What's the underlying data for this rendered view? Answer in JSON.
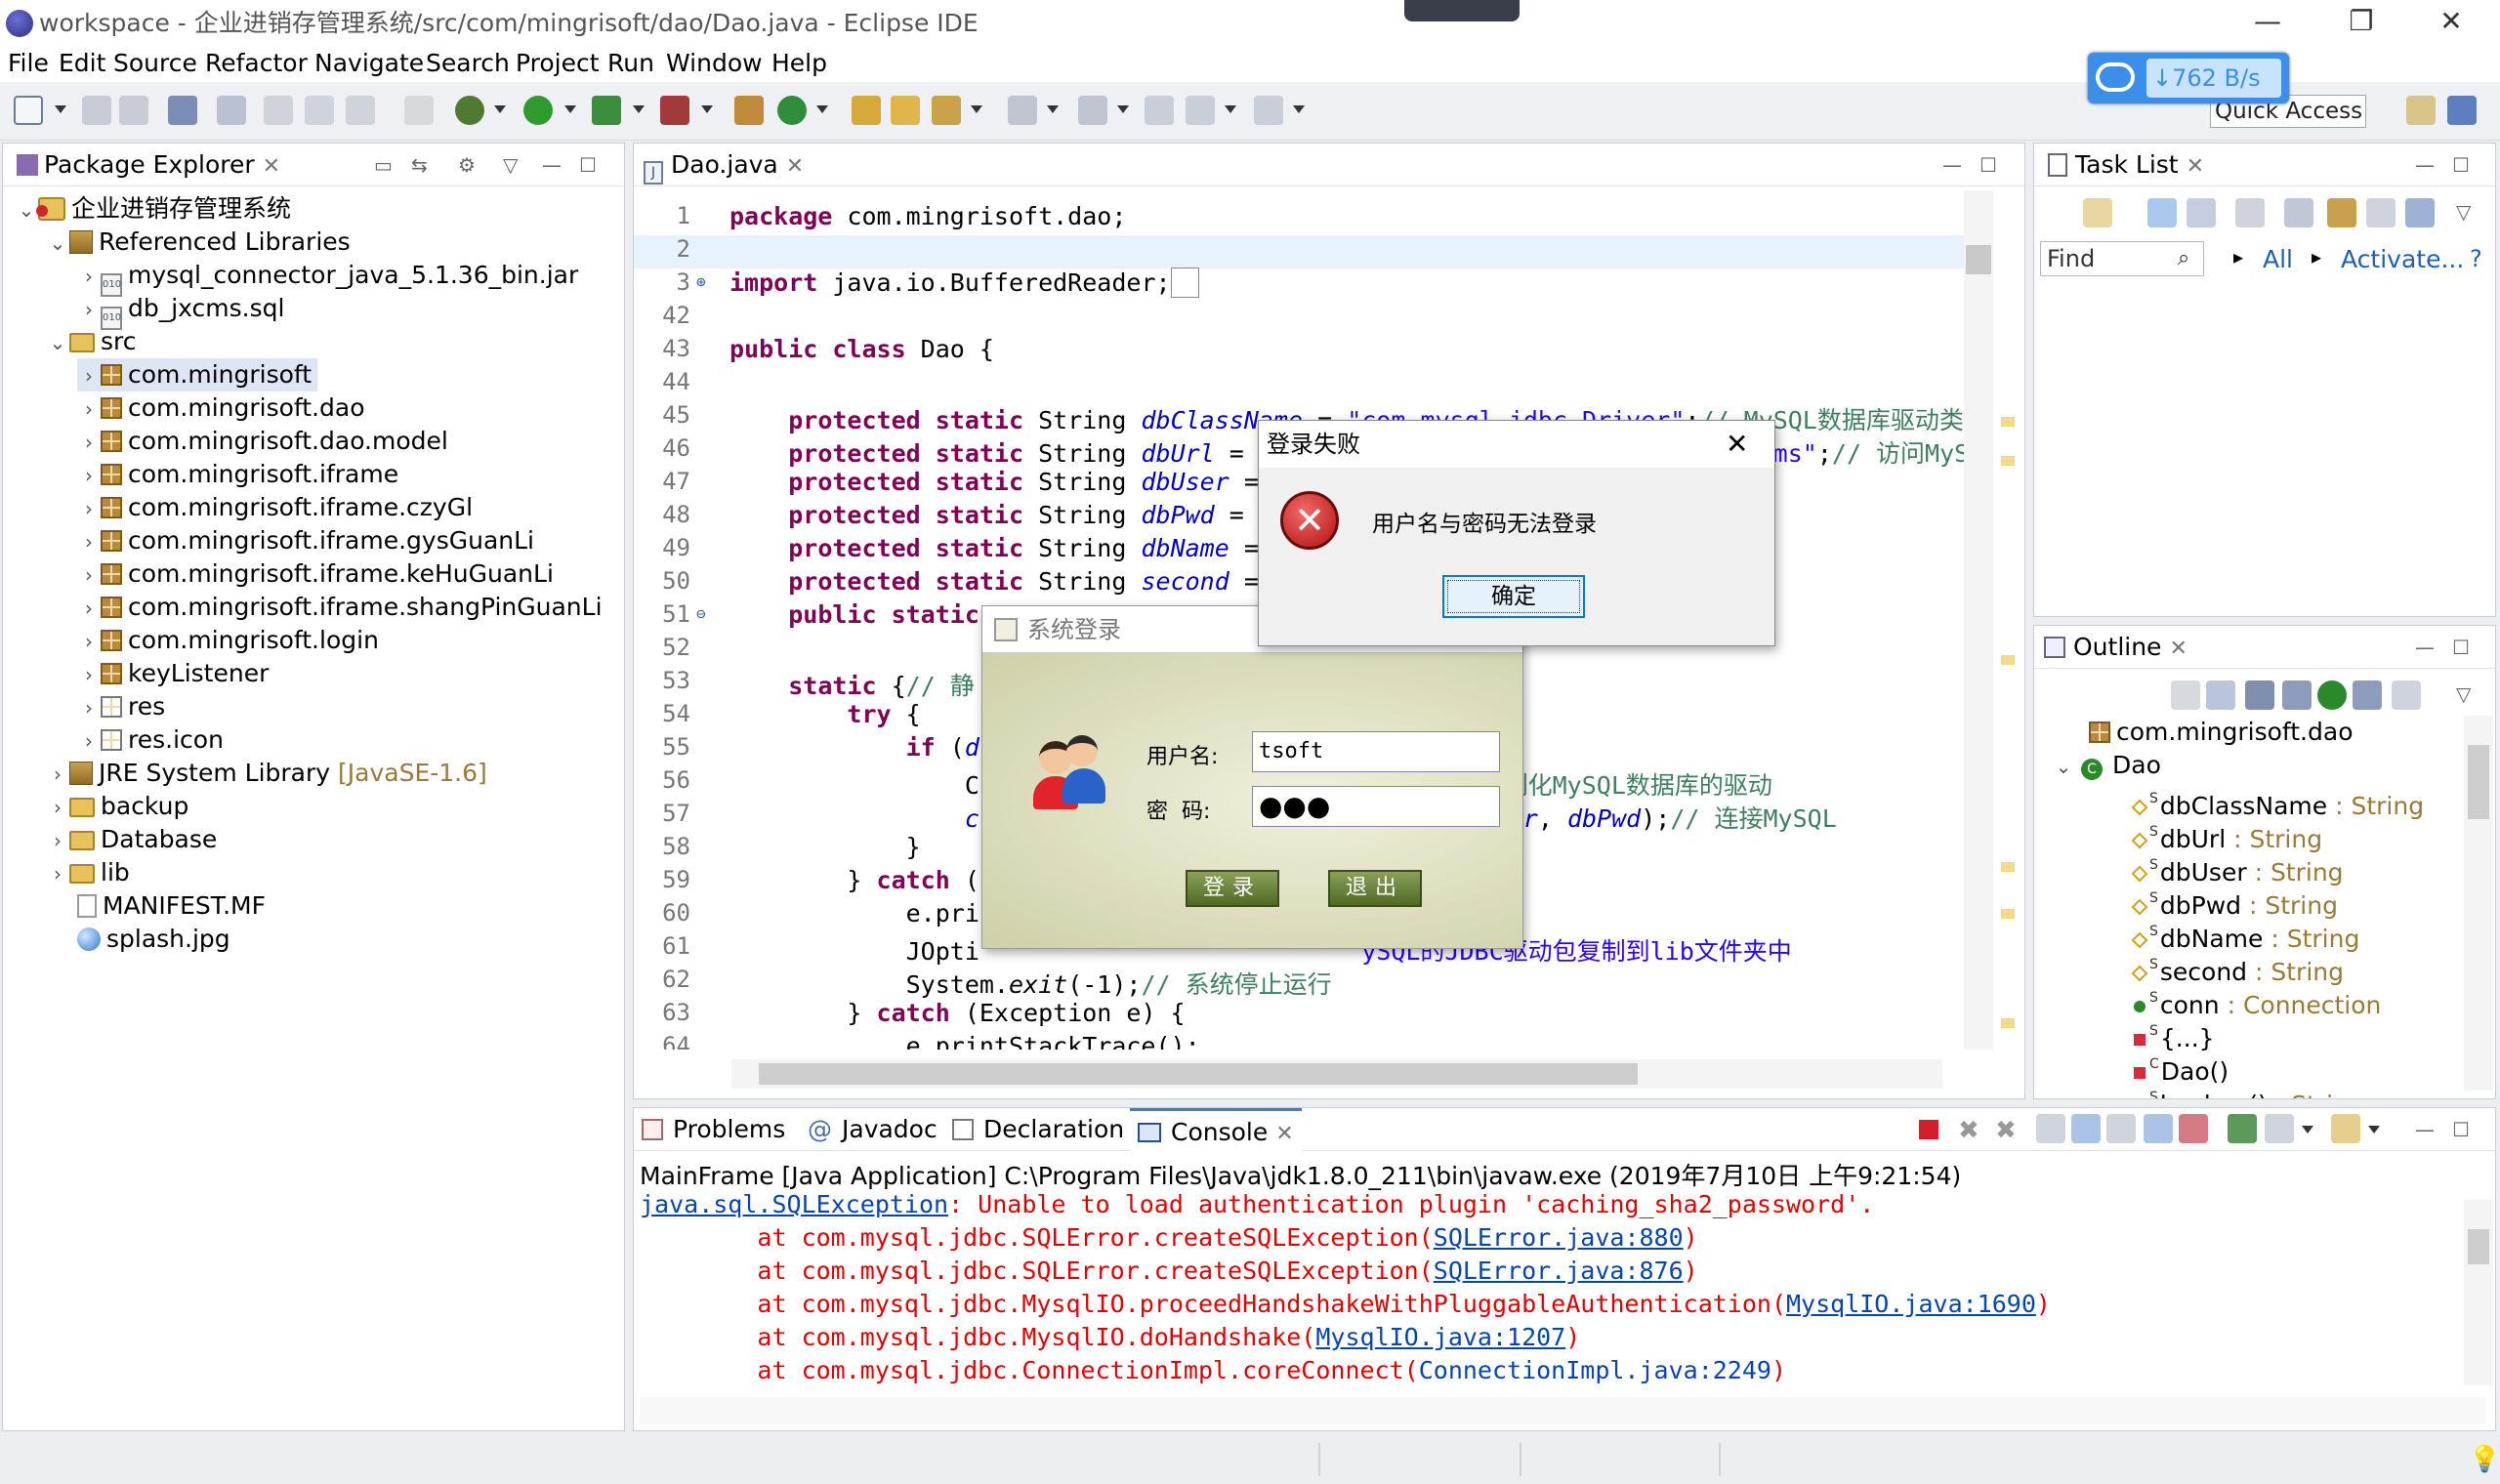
{
  "window": {
    "title": "workspace - 企业进销存管理系统/src/com/mingrisoft/dao/Dao.java - Eclipse IDE",
    "minimize": "—",
    "restore": "❐",
    "close": "✕"
  },
  "menu": [
    "File",
    "Edit",
    "Source",
    "Refactor",
    "Navigate",
    "Search",
    "Project",
    "Run",
    "Window",
    "Help"
  ],
  "quick_access": "Quick Access",
  "net_speed": "762 B/s",
  "package_explorer": {
    "tab": "Package Explorer",
    "rows": [
      {
        "label": "企业进销存管理系统",
        "extra": ""
      },
      {
        "label": "Referenced Libraries",
        "extra": ""
      },
      {
        "label": "mysql_connector_java_5.1.36_bin.jar",
        "extra": ""
      },
      {
        "label": "db_jxcms.sql",
        "extra": ""
      },
      {
        "label": "src",
        "extra": ""
      },
      {
        "label": "com.mingrisoft",
        "extra": ""
      },
      {
        "label": "com.mingrisoft.dao",
        "extra": ""
      },
      {
        "label": "com.mingrisoft.dao.model",
        "extra": ""
      },
      {
        "label": "com.mingrisoft.iframe",
        "extra": ""
      },
      {
        "label": "com.mingrisoft.iframe.czyGl",
        "extra": ""
      },
      {
        "label": "com.mingrisoft.iframe.gysGuanLi",
        "extra": ""
      },
      {
        "label": "com.mingrisoft.iframe.keHuGuanLi",
        "extra": ""
      },
      {
        "label": "com.mingrisoft.iframe.shangPinGuanLi",
        "extra": ""
      },
      {
        "label": "com.mingrisoft.login",
        "extra": ""
      },
      {
        "label": "keyListener",
        "extra": ""
      },
      {
        "label": "res",
        "extra": ""
      },
      {
        "label": "res.icon",
        "extra": ""
      },
      {
        "label": "JRE System Library",
        "extra": "[JavaSE-1.6]"
      },
      {
        "label": "backup",
        "extra": ""
      },
      {
        "label": "Database",
        "extra": ""
      },
      {
        "label": "lib",
        "extra": ""
      },
      {
        "label": "MANIFEST.MF",
        "extra": ""
      },
      {
        "label": "splash.jpg",
        "extra": ""
      }
    ]
  },
  "editor": {
    "tab": "Dao.java",
    "line_numbers": [
      "1",
      "2",
      "3",
      "42",
      "43",
      "44",
      "45",
      "46",
      "47",
      "48",
      "49",
      "50",
      "51",
      "52",
      "53",
      "54",
      "55",
      "56",
      "57",
      "58",
      "59",
      "60",
      "61",
      "62",
      "63",
      "64"
    ]
  },
  "task_list": {
    "tab": "Task List",
    "find_placeholder": "Find",
    "all": "All",
    "activate": "Activate..."
  },
  "outline": {
    "tab": "Outline",
    "items": [
      {
        "name": "com.mingrisoft.dao",
        "type": ""
      },
      {
        "name": "Dao",
        "type": ""
      },
      {
        "name": "dbClassName",
        "type": " : String"
      },
      {
        "name": "dbUrl",
        "type": " : String"
      },
      {
        "name": "dbUser",
        "type": " : String"
      },
      {
        "name": "dbPwd",
        "type": " : String"
      },
      {
        "name": "dbName",
        "type": " : String"
      },
      {
        "name": "second",
        "type": " : String"
      },
      {
        "name": "conn",
        "type": " : Connection"
      },
      {
        "name": "{...}",
        "type": ""
      },
      {
        "name": "Dao()",
        "type": ""
      },
      {
        "name": "backup()",
        "type": " : String"
      }
    ]
  },
  "bottom_tabs": {
    "problems": "Problems",
    "javadoc": "Javadoc",
    "declaration": "Declaration",
    "console": "Console"
  },
  "console": {
    "header": "MainFrame [Java Application] C:\\Program Files\\Java\\jdk1.8.0_211\\bin\\javaw.exe (2019年7月10日 上午9:21:54)",
    "exception_link": "java.sql.SQLException",
    "exception_msg": ": Unable to load authentication plugin 'caching_sha2_password'.",
    "stack": [
      {
        "prefix": "        at com.mysql.jdbc.SQLError.createSQLException(",
        "link": "SQLError.java:880",
        "suffix": ")"
      },
      {
        "prefix": "        at com.mysql.jdbc.SQLError.createSQLException(",
        "link": "SQLError.java:876",
        "suffix": ")"
      },
      {
        "prefix": "        at com.mysql.jdbc.MysqlIO.proceedHandshakeWithPluggableAuthentication(",
        "link": "MysqlIO.java:1690",
        "suffix": ")"
      },
      {
        "prefix": "        at com.mysql.jdbc.MysqlIO.doHandshake(",
        "link": "MysqlIO.java:1207",
        "suffix": ")"
      },
      {
        "prefix": "        at com.mysql.jdbc.ConnectionImpl.coreConnect(",
        "link": "ConnectionImpl.java:2249",
        "suffix": ")"
      }
    ]
  },
  "error_dialog": {
    "title": "登录失败",
    "message": "用户名与密码无法登录",
    "ok": "确定"
  },
  "login_dialog": {
    "title": "系统登录",
    "user_label": "用户名:",
    "pwd_label": "密  码:",
    "user_value": "tsoft",
    "pwd_value": "●●●",
    "login_btn": "登录",
    "exit_btn": "退出"
  },
  "colors": {
    "keyword": "#7f0055",
    "field": "#0000c0",
    "string": "#2a00ff",
    "comment": "#3f7f5f",
    "error": "#e00000",
    "link": "#0645ad"
  }
}
